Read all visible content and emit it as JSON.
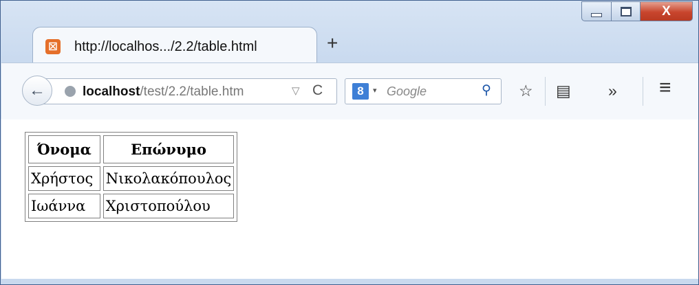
{
  "tab": {
    "title": "http://localhos.../2.2/table.html",
    "favicon": "xampp-icon",
    "new_tab_label": "+"
  },
  "window_controls": {
    "minimize": "minimize",
    "maximize": "maximize",
    "close_glyph": "X"
  },
  "navbar": {
    "back_glyph": "←",
    "url_host": "localhost",
    "url_path": "/test/2.2/table.htm",
    "dropmarker": "▽",
    "reload_glyph": "C",
    "search_engine_letter": "8",
    "search_placeholder": "Google",
    "search_go_glyph": "⚲",
    "bookmark_glyph": "☆",
    "reading_list_glyph": "▤",
    "overflow_glyph": "»",
    "menu_glyph": "≡"
  },
  "table": {
    "headers": [
      "Όνομα",
      "Επώνυμο"
    ],
    "rows": [
      [
        "Χρήστος",
        "Νικολακόπουλος"
      ],
      [
        "Ιωάννα",
        "Χριστοπούλου"
      ]
    ]
  },
  "colors": {
    "frame": "#c9d9ee",
    "close_button": "#c8452d",
    "tab_icon": "#e56f2a",
    "search_icon": "#3e7fd6"
  }
}
